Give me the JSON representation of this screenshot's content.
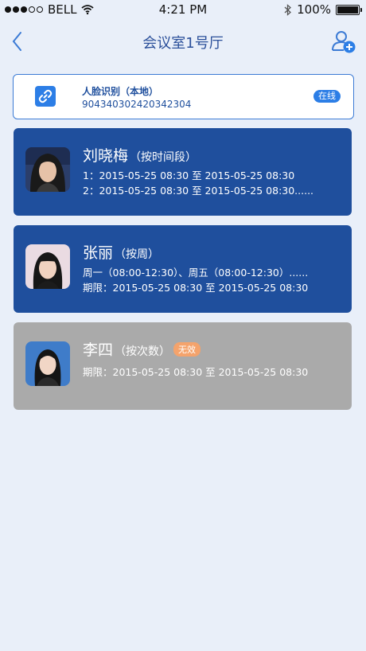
{
  "status_bar": {
    "carrier": "BELL",
    "time": "4:21 PM",
    "battery": "100%"
  },
  "nav": {
    "title": "会议室1号厅"
  },
  "device": {
    "name": "人脸识别（本地）",
    "id": "904340302420342304",
    "status": "在线"
  },
  "persons": [
    {
      "name": "刘晓梅",
      "mode": "（按时间段）",
      "lines": [
        "1：2015-05-25 08:30  至  2015-05-25 08:30",
        "2：2015-05-25 08:30  至  2015-05-25 08:30......"
      ]
    },
    {
      "name": "张丽",
      "mode": "（按周）",
      "lines": [
        "周一（08:00-12:30）、周五（08:00-12:30）......",
        "期限：2015-05-25 08:30  至  2015-05-25 08:30"
      ]
    },
    {
      "name": "李四",
      "mode": "（按次数）",
      "badge": "无效",
      "lines": [
        "期限：2015-05-25 08:30  至  2015-05-25 08:30"
      ]
    }
  ],
  "colors": {
    "primary": "#1f4f9d",
    "accent": "#2c7ee6",
    "inactive": "#aaaaaa",
    "badge_invalid": "#f4a36c",
    "background": "#e9eff9"
  }
}
